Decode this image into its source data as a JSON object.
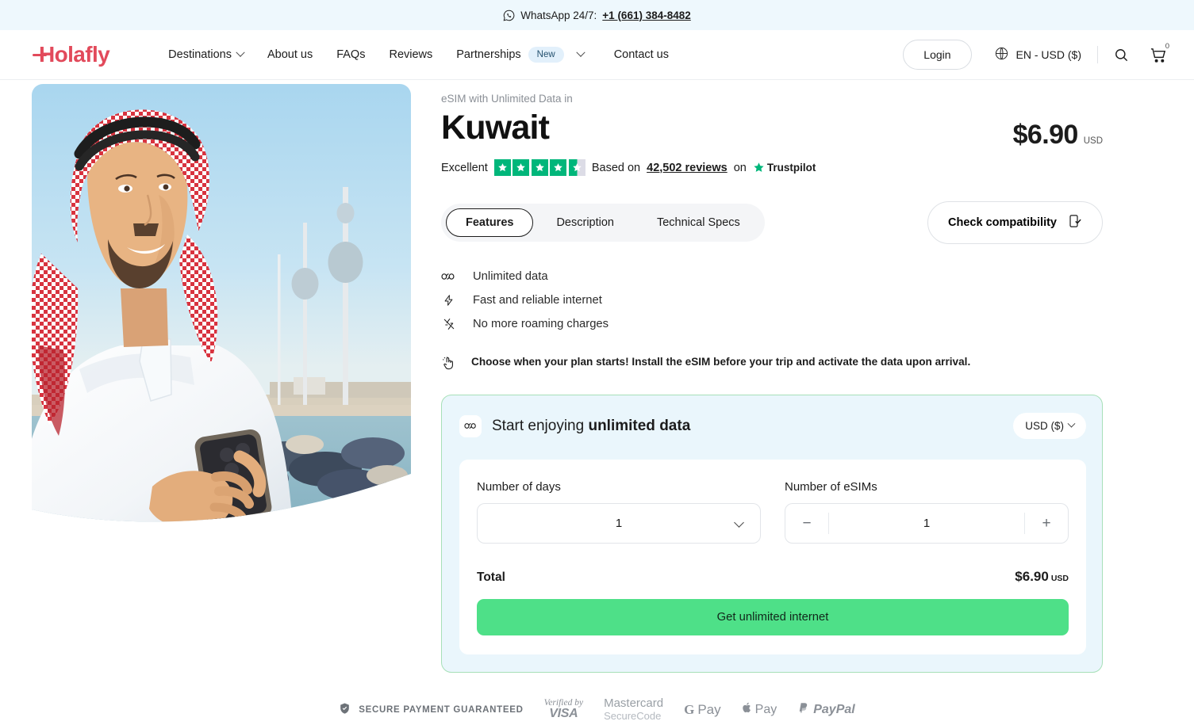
{
  "topbar": {
    "icon": "whatsapp-icon",
    "text": "WhatsApp 24/7:",
    "phone": "+1 (661) 384-8482"
  },
  "header": {
    "logo": "Holafly",
    "nav": [
      {
        "label": "Destinations",
        "has_chevron": true,
        "badge": ""
      },
      {
        "label": "About us",
        "has_chevron": false,
        "badge": ""
      },
      {
        "label": "FAQs",
        "has_chevron": false,
        "badge": ""
      },
      {
        "label": "Reviews",
        "has_chevron": false,
        "badge": ""
      },
      {
        "label": "Partnerships",
        "has_chevron": true,
        "badge": "New"
      },
      {
        "label": "Contact us",
        "has_chevron": false,
        "badge": ""
      }
    ],
    "login_label": "Login",
    "locale": "EN - USD ($)",
    "search_icon": "search-icon",
    "cart_icon": "cart-icon",
    "cart_count": "0"
  },
  "product": {
    "eyebrow": "eSIM with Unlimited Data in",
    "title": "Kuwait",
    "price": "$6.90",
    "price_currency": "USD"
  },
  "trustpilot": {
    "rating_word": "Excellent",
    "stars_filled": 4.5,
    "stars_total": 5,
    "based_on": "Based on",
    "reviews_count": "42,502 reviews",
    "on": "on",
    "brand": "Trustpilot",
    "star_color": "#00b67a"
  },
  "tabs": [
    {
      "label": "Features",
      "active": true
    },
    {
      "label": "Description",
      "active": false
    },
    {
      "label": "Technical Specs",
      "active": false
    }
  ],
  "compatibility": {
    "label": "Check compatibility",
    "icon": "phone-check-icon"
  },
  "features": [
    {
      "icon": "infinity-icon",
      "label": "Unlimited data"
    },
    {
      "icon": "lightning-icon",
      "label": "Fast and reliable internet"
    },
    {
      "icon": "lightning-off-icon",
      "label": "No more roaming charges"
    }
  ],
  "notice": {
    "icon": "click-hand-icon",
    "text": "Choose when your plan starts! Install the eSIM before your trip and activate the data upon arrival."
  },
  "purchase": {
    "icon": "infinity-icon",
    "heading_prefix": "Start enjoying ",
    "heading_bold": "unlimited data",
    "currency_selector": "USD ($)",
    "days_label": "Number of days",
    "days_value": "1",
    "esims_label": "Number of eSIMs",
    "esims_value": "1",
    "decrement": "−",
    "increment": "+",
    "total_label": "Total",
    "total_price": "$6.90",
    "total_currency": "USD",
    "cta_label": "Get unlimited internet",
    "cta_color": "#4ee088",
    "box_bg": "#eaf6fc",
    "box_border": "#a7e0b8"
  },
  "payments": {
    "secure_icon": "shield-check-icon",
    "secure_text": "SECURE PAYMENT GUARANTEED",
    "visa_line1": "Verified by",
    "visa_line2": "VISA",
    "mastercard_line1": "Mastercard",
    "mastercard_line2": "SecureCode",
    "gpay_g": "G",
    "gpay_text": "Pay",
    "apple_pay": "Pay",
    "paypal": "PayPal"
  },
  "theme": {
    "brand_red": "#e24a5b",
    "topbar_bg": "#eef8fd",
    "green": "#4ee088",
    "trust_green": "#00b67a"
  }
}
